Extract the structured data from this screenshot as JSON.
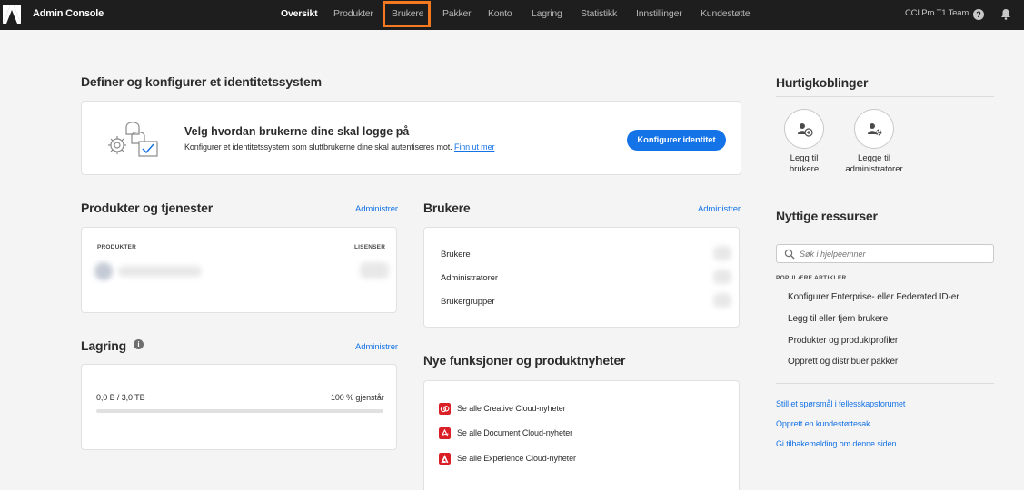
{
  "app": {
    "title": "Admin Console",
    "org": "CCI Pro T1 Team"
  },
  "nav": [
    {
      "label": "Oversikt",
      "active": true
    },
    {
      "label": "Produkter",
      "active": false
    },
    {
      "label": "Brukere",
      "active": false,
      "highlighted": true
    },
    {
      "label": "Pakker",
      "active": false
    },
    {
      "label": "Konto",
      "active": false
    },
    {
      "label": "Lagring",
      "active": false
    },
    {
      "label": "Statistikk",
      "active": false
    },
    {
      "label": "Innstillinger",
      "active": false
    },
    {
      "label": "Kundestøtte",
      "active": false
    }
  ],
  "identity": {
    "heading": "Definer og konfigurer et identitetssystem",
    "title": "Velg hvordan brukerne dine skal logge på",
    "description": "Konfigurer et identitetssystem som sluttbrukerne dine skal autentiseres mot.",
    "link": "Finn ut mer",
    "button": "Konfigurer identitet"
  },
  "products": {
    "heading": "Produkter og tjenester",
    "manage": "Administrer",
    "col_products": "PRODUKTER",
    "col_licenses": "LISENSER"
  },
  "users": {
    "heading": "Brukere",
    "manage": "Administrer",
    "rows": [
      "Brukere",
      "Administratorer",
      "Brukergrupper"
    ]
  },
  "storage": {
    "heading": "Lagring",
    "manage": "Administrer",
    "usage": "0,0 B / 3,0 TB",
    "remaining": "100 % gjenstår",
    "used_fraction": 0
  },
  "news": {
    "heading": "Nye funksjoner og produktnyheter",
    "items": [
      {
        "label": "Se alle Creative Cloud-nyheter",
        "icon": "creative-cloud-icon",
        "color": "#da1f26"
      },
      {
        "label": "Se alle Document Cloud-nyheter",
        "icon": "acrobat-icon",
        "color": "#da1f26"
      },
      {
        "label": "Se alle Experience Cloud-nyheter",
        "icon": "adobe-icon",
        "color": "#da1f26"
      }
    ]
  },
  "quicklinks": {
    "heading": "Hurtigkoblinger",
    "items": [
      {
        "line1": "Legg til",
        "line2": "brukere",
        "icon": "add-user-icon"
      },
      {
        "line1": "Legge til",
        "line2": "administratorer",
        "icon": "add-admin-icon"
      }
    ]
  },
  "resources": {
    "heading": "Nyttige ressurser",
    "search_placeholder": "Søk i hjelpeemner",
    "popular_heading": "POPULÆRE ARTIKLER",
    "articles": [
      "Konfigurer Enterprise- eller Federated ID-er",
      "Legg til eller fjern brukere",
      "Produkter og produktprofiler",
      "Opprett og distribuer pakker"
    ],
    "links": [
      "Still et spørsmål i fellesskapsforumet",
      "Opprett en kundestøttesak",
      "Gi tilbakemelding om denne siden"
    ]
  },
  "colors": {
    "accent": "#1473e6",
    "topbar": "#1e1e1e",
    "highlight": "#f47920"
  }
}
